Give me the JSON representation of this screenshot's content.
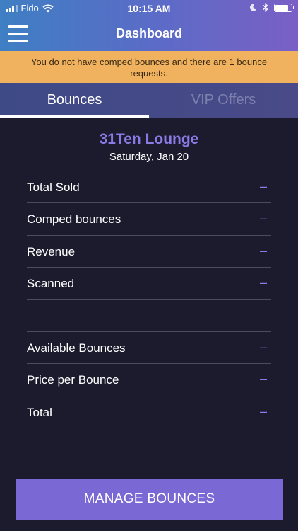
{
  "status_bar": {
    "carrier": "Fido",
    "time": "10:15 AM"
  },
  "nav": {
    "title": "Dashboard",
    "menu_icon": "hamburger-menu-icon"
  },
  "alert": {
    "message": "You do not have comped bounces and there are 1 bounce requests."
  },
  "tabs": [
    {
      "label": "Bounces",
      "active": true
    },
    {
      "label": "VIP Offers",
      "active": false
    }
  ],
  "venue": {
    "name": "31Ten Lounge",
    "date": "Saturday, Jan 20"
  },
  "stats_group_1": [
    {
      "label": "Total Sold",
      "value": "–"
    },
    {
      "label": "Comped bounces",
      "value": "–"
    },
    {
      "label": "Revenue",
      "value": "–"
    },
    {
      "label": "Scanned",
      "value": "–"
    }
  ],
  "stats_group_2": [
    {
      "label": "Available Bounces",
      "value": "–"
    },
    {
      "label": "Price per Bounce",
      "value": "–"
    },
    {
      "label": "Total",
      "value": "–"
    }
  ],
  "actions": {
    "manage_label": "MANAGE BOUNCES"
  },
  "colors": {
    "background": "#1c1b2e",
    "accent": "#8a7ae6",
    "button": "#7a68d4",
    "alert": "#f0b25e"
  }
}
